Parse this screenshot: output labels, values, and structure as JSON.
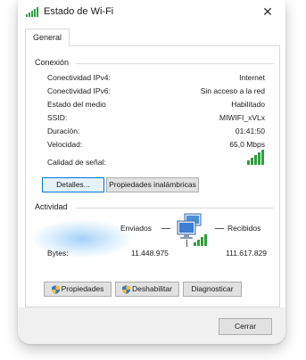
{
  "window": {
    "title": "Estado de Wi-Fi",
    "close_glyph": "✕"
  },
  "tabs": [
    {
      "label": "General"
    }
  ],
  "connection": {
    "heading": "Conexión",
    "rows": [
      {
        "label": "Conectividad IPv4:",
        "value": "Internet"
      },
      {
        "label": "Conectividad IPv6:",
        "value": "Sin acceso a la red"
      },
      {
        "label": "Estado del medio",
        "value": "Habilitado"
      },
      {
        "label": "SSID:",
        "value": "MIWIFI_xVLx"
      },
      {
        "label": "Duración:",
        "value": "01:41:50"
      },
      {
        "label": "Velocidad:",
        "value": "65,0 Mbps"
      }
    ],
    "signal_label": "Calidad de señal:",
    "signal_bars": 5,
    "details_button": "Detalles...",
    "wireless_props_button": "Propiedades inalámbricas"
  },
  "activity": {
    "heading": "Actividad",
    "sent_label": "Enviados",
    "received_label": "Recibidos",
    "bytes_label": "Bytes:",
    "bytes_sent": "11.448.975",
    "bytes_received": "111.617.829",
    "network_icon": "network-computers-icon"
  },
  "actions": {
    "properties_button": "Propiedades",
    "disable_button": "Deshabilitar",
    "diagnose_button": "Diagnosticar"
  },
  "footer": {
    "close_button": "Cerrar"
  },
  "colors": {
    "signal_green": "#2e9e3e",
    "focus_blue": "#0078d7"
  }
}
